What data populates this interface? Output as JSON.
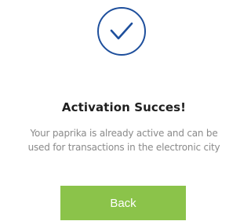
{
  "success_dialog": {
    "icon": "check-circle-icon",
    "title": "Activation Succes!",
    "message_line_1": "Your paprika is already active and can be",
    "message_line_2": "used for transactions in the electronic city",
    "back_label": "Back"
  },
  "colors": {
    "icon_blue": "#1e4f9c",
    "button_green": "#8bc34a",
    "title_text": "#1f1f1f",
    "message_text": "#8a8a8a"
  }
}
